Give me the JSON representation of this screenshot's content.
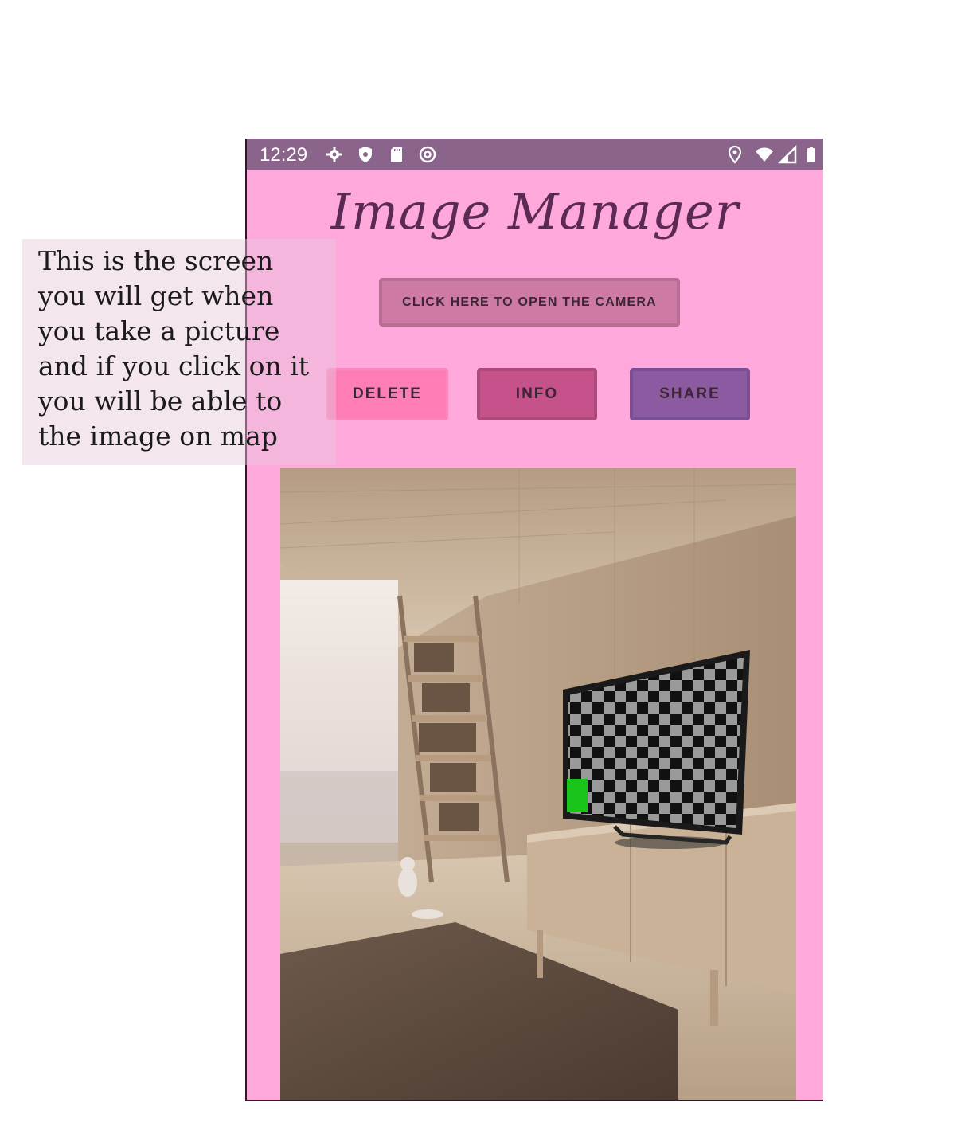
{
  "status_bar": {
    "time": "12:29",
    "left_icons": [
      "gear-icon",
      "shield-icon",
      "sd-card-icon",
      "at-sign-icon"
    ],
    "right_icons": [
      "location-icon",
      "wifi-icon",
      "signal-icon",
      "battery-icon"
    ]
  },
  "app": {
    "title": "Image Manager",
    "camera_button_label": "CLICK HERE TO OPEN THE CAMERA",
    "actions": {
      "delete_label": "DELETE",
      "info_label": "INFO",
      "share_label": "SHARE"
    }
  },
  "note": {
    "text": "This is the screen\nyou will get when\nyou take a picture\nand if you click on it\nyou will be able to\nthe image on map"
  },
  "colors": {
    "background": "#ffa8dc",
    "status_bar": "#8a648b",
    "title": "#5a2a55",
    "delete": "#fd7db4",
    "info": "#c5528a",
    "share": "#8c5aa0"
  }
}
